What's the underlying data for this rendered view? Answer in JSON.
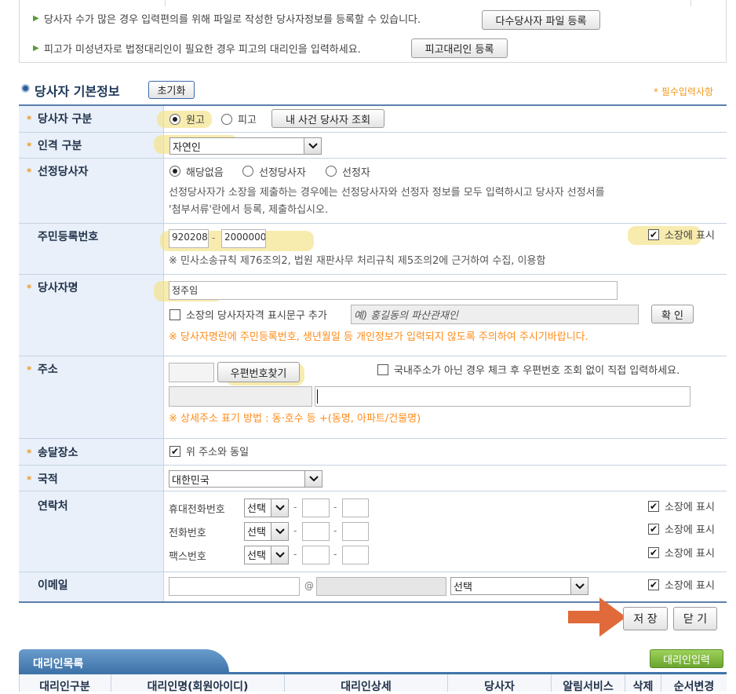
{
  "notices": {
    "multi_party": "당사자 수가 많은 경우 입력편의를 위해 파일로 작성한 당사자정보를 등록할 수 있습니다.",
    "multi_party_button": "다수당사자 파일 등록",
    "minor_defendant": "피고가 미성년자로 법정대리인이 필요한 경우 피고의 대리인을 입력하세요.",
    "minor_defendant_button": "피고대리인 등록"
  },
  "section": {
    "title": "당사자 기본정보",
    "reset_button": "초기화",
    "required_note": "* 필수입력사항"
  },
  "form": {
    "party_type": {
      "label": "당사자 구분",
      "options": [
        "원고",
        "피고"
      ],
      "selected": "원고",
      "lookup_button": "내 사건 당사자 조회"
    },
    "person_type": {
      "label": "인격 구분",
      "value": "자연인"
    },
    "designated": {
      "label": "선정당사자",
      "options": [
        "해당없음",
        "선정당사자",
        "선정자"
      ],
      "selected": "해당없음",
      "note_line1": "선정당사자가 소장을 제출하는 경우에는 선정당사자와 선정자 정보를 모두 입력하시고 당사자 선정서를",
      "note_line2": "'첨부서류'란에서 등록, 제출하십시오."
    },
    "rrn": {
      "label": "주민등록번호",
      "front": "920208",
      "back": "2000000",
      "dash": "-",
      "show_label": "소장에 표시",
      "show_checked": true,
      "note": "※ 민사소송규칙 제76조의2, 법원 재판사무 처리규칙 제5조의2에 근거하여 수집, 이용함"
    },
    "name": {
      "label": "당사자명",
      "value": "정주임",
      "qualifier_label": "소장의 당사자자격 표시문구 추가",
      "qualifier_placeholder": "예) 홍길동의 파산관재인",
      "confirm_button": "확 인",
      "warning": "※ 당사자명란에 주민등록번호, 생년월일 등 개인정보가 입력되지 않도록 주의하여 주시기바랍니다."
    },
    "address": {
      "label": "주소",
      "zip_button": "우편번호찾기",
      "foreign_label": "국내주소가 아닌 경우 체크 후 우편번호 조회 없이 직접 입력하세요.",
      "note": "※ 상세주소 표기 방법 : 동·호수 등 +(동명, 아파트/건물명)"
    },
    "delivery": {
      "label": "송달장소",
      "same_label": "위 주소와 동일",
      "checked": true
    },
    "nationality": {
      "label": "국적",
      "value": "대한민국"
    },
    "contact": {
      "label": "연락처",
      "rows": [
        {
          "label": "휴대전화번호",
          "select": "선택",
          "show_label": "소장에 표시"
        },
        {
          "label": "전화번호",
          "select": "선택",
          "show_label": "소장에 표시"
        },
        {
          "label": "팩스번호",
          "select": "선택",
          "show_label": "소장에 표시"
        }
      ],
      "dash": "-"
    },
    "email": {
      "label": "이메일",
      "at": "@",
      "domain_select": "선택",
      "show_label": "소장에 표시"
    }
  },
  "actions": {
    "save": "저 장",
    "close": "닫 기"
  },
  "agents": {
    "tab_title": "대리인목록",
    "add_button": "대리인입력",
    "columns": [
      "대리인구분",
      "대리인명(회원아이디)",
      "대리인상세",
      "당사자",
      "알림서비스",
      "삭제",
      "순서변경"
    ]
  },
  "colors": {
    "required": "#f29a1c",
    "warning": "#ff8c1a",
    "label_bg": "#e9f0f9",
    "tab_bg": "#4a82b8",
    "add_btn": "#78b43a",
    "arrow": "#e06a3a"
  }
}
